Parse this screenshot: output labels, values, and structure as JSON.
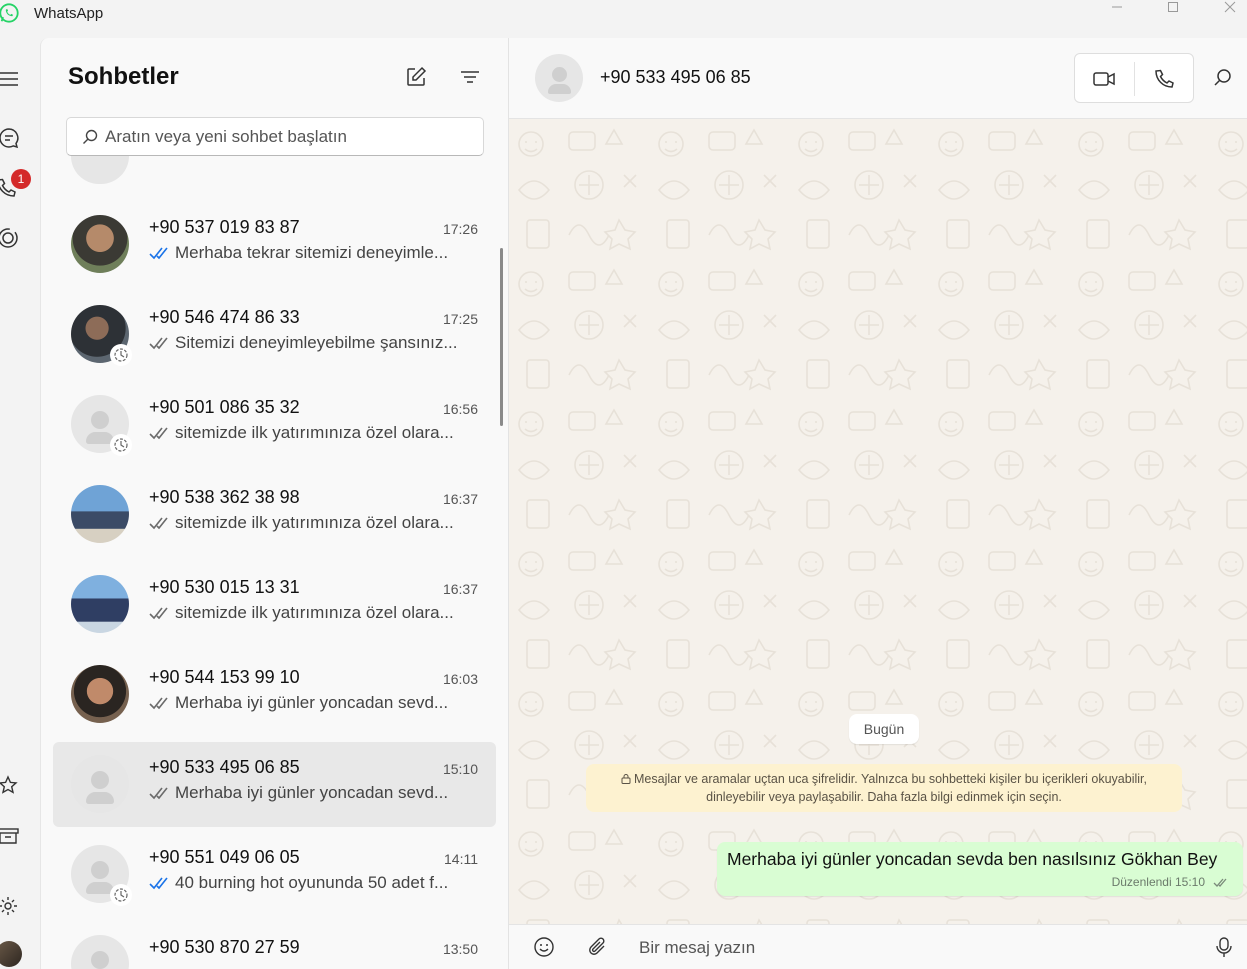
{
  "app": {
    "title": "WhatsApp"
  },
  "rail": {
    "calls_badge": "1"
  },
  "list": {
    "title": "Sohbetler",
    "search_placeholder": "Aratın veya yeni sohbet başlatın",
    "chats": [
      {
        "name": "+90 537 019 83 87",
        "time": "17:26",
        "preview": "Merhaba tekrar sitemizi deneyimle...",
        "ticks": "read",
        "avatar": "photo-1",
        "timer": false
      },
      {
        "name": "+90 546 474 86 33",
        "time": "17:25",
        "preview": "Sitemizi deneyimleyebilme şansınız...",
        "ticks": "delivered",
        "avatar": "photo-2",
        "timer": true
      },
      {
        "name": "+90 501 086 35 32",
        "time": "16:56",
        "preview": "sitemizde ilk yatırımınıza özel olara...",
        "ticks": "delivered",
        "avatar": "default",
        "timer": true
      },
      {
        "name": "+90 538 362 38 98",
        "time": "16:37",
        "preview": "sitemizde ilk yatırımınıza özel olara...",
        "ticks": "delivered",
        "avatar": "photo-3",
        "timer": false
      },
      {
        "name": "+90 530 015 13 31",
        "time": "16:37",
        "preview": "sitemizde ilk yatırımınıza özel olara...",
        "ticks": "delivered",
        "avatar": "photo-4",
        "timer": false
      },
      {
        "name": "+90 544 153 99 10",
        "time": "16:03",
        "preview": "Merhaba iyi günler yoncadan sevd...",
        "ticks": "delivered",
        "avatar": "photo-5",
        "timer": false
      },
      {
        "name": "+90 533 495 06 85",
        "time": "15:10",
        "preview": "Merhaba iyi günler yoncadan sevd...",
        "ticks": "delivered",
        "avatar": "default",
        "timer": false,
        "selected": true
      },
      {
        "name": "+90 551 049 06 05",
        "time": "14:11",
        "preview": "40 burning hot oyununda 50 adet f...",
        "ticks": "read",
        "avatar": "default",
        "timer": true
      },
      {
        "name": "+90 530 870 27 59",
        "time": "13:50",
        "preview": "",
        "ticks": "none",
        "avatar": "default",
        "timer": false
      }
    ]
  },
  "conversation": {
    "contact_name": "+90 533 495 06 85",
    "date_label": "Bugün",
    "encryption_notice": "Mesajlar ve aramalar uçtan uca şifrelidir. Yalnızca bu sohbetteki kişiler bu içerikleri okuyabilir, dinleyebilir veya paylaşabilir. Daha fazla bilgi edinmek için seçin.",
    "message": {
      "text": "Merhaba iyi günler yoncadan sevda ben nasılsınız Gökhan Bey",
      "meta": "Düzenlendi 15:10"
    },
    "composer_placeholder": "Bir mesaj yazın"
  },
  "colors": {
    "read_tick": "#1a73e8",
    "delivered_tick": "#6b6b6b",
    "badge": "#d42a2a",
    "bubble": "#d9fdd3",
    "notice": "#fdf2d0",
    "wallpaper": "#f5f1eb"
  }
}
